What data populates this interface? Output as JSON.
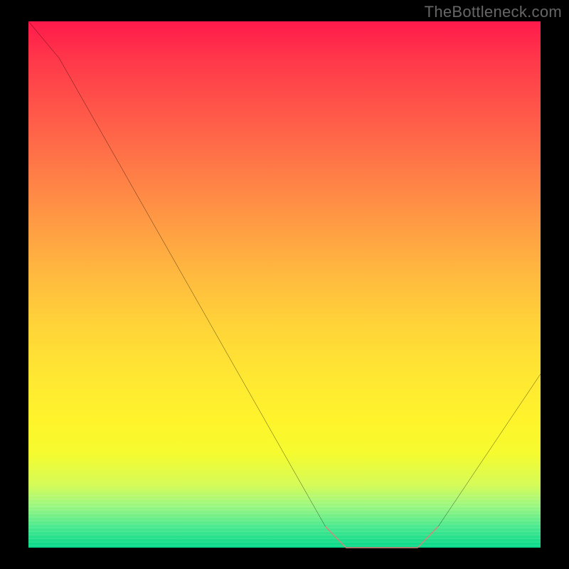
{
  "watermark": "TheBottleneck.com",
  "chart_data": {
    "type": "line",
    "title": "",
    "xlabel": "",
    "ylabel": "",
    "xlim": [
      0,
      100
    ],
    "ylim": [
      0,
      100
    ],
    "series": [
      {
        "name": "curve",
        "x": [
          0,
          6,
          58,
          62,
          76,
          80,
          100
        ],
        "values": [
          100,
          93,
          4,
          0,
          0,
          4,
          33
        ]
      }
    ],
    "highlight_segment": {
      "x": [
        58,
        62,
        76,
        80
      ],
      "values": [
        4,
        0,
        0,
        4
      ],
      "color": "#d88076"
    },
    "gradient_stops": [
      {
        "pos": 0.0,
        "color": "#ff1a4b"
      },
      {
        "pos": 0.18,
        "color": "#ff5a49"
      },
      {
        "pos": 0.38,
        "color": "#ff9a44"
      },
      {
        "pos": 0.58,
        "color": "#ffd438"
      },
      {
        "pos": 0.76,
        "color": "#fff42c"
      },
      {
        "pos": 0.92,
        "color": "#9cf77f"
      },
      {
        "pos": 1.0,
        "color": "#04d989"
      }
    ]
  }
}
